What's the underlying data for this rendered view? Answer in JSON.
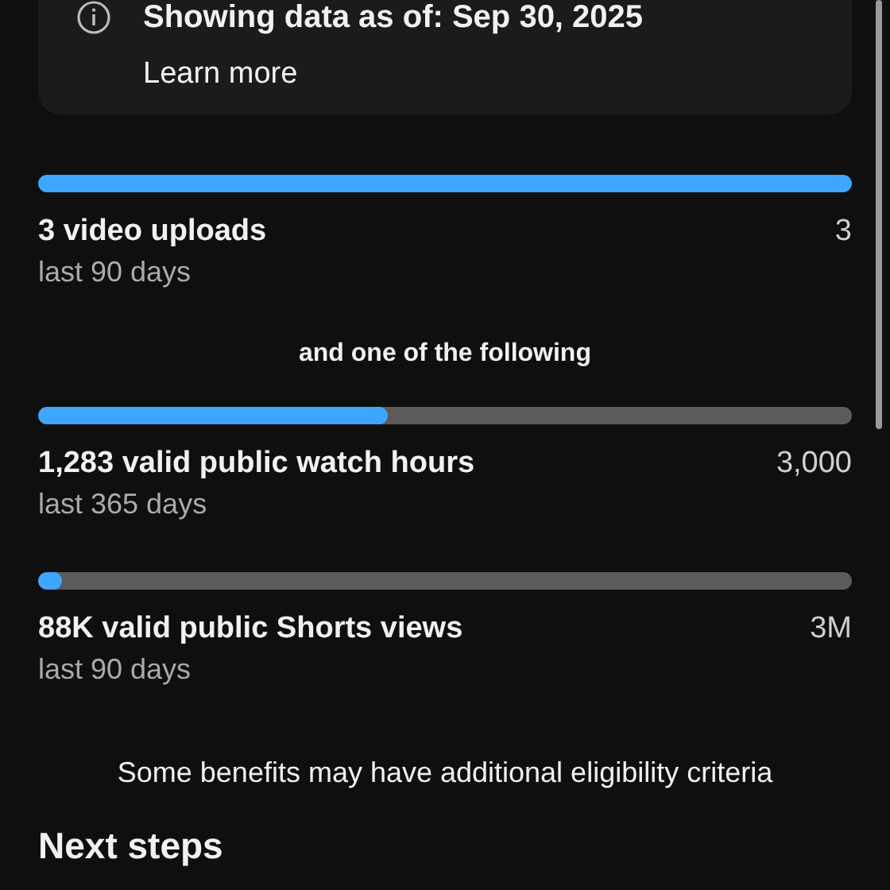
{
  "notice": {
    "title": "Showing data as of: Sep 30, 2025",
    "link": "Learn more"
  },
  "requirements": [
    {
      "title": "3 video uploads",
      "period": "last 90 days",
      "target": "3",
      "level": 1.0
    }
  ],
  "separator": "and one of the following",
  "alternatives": [
    {
      "title": "1,283 valid public watch hours",
      "period": "last 365 days",
      "target": "3,000",
      "level": 0.43
    },
    {
      "title": "88K valid public Shorts views",
      "period": "last 90 days",
      "target": "3M",
      "level": 0.03
    }
  ],
  "footnote": "Some benefits may have additional eligibility criteria",
  "section_heading": "Next steps"
}
